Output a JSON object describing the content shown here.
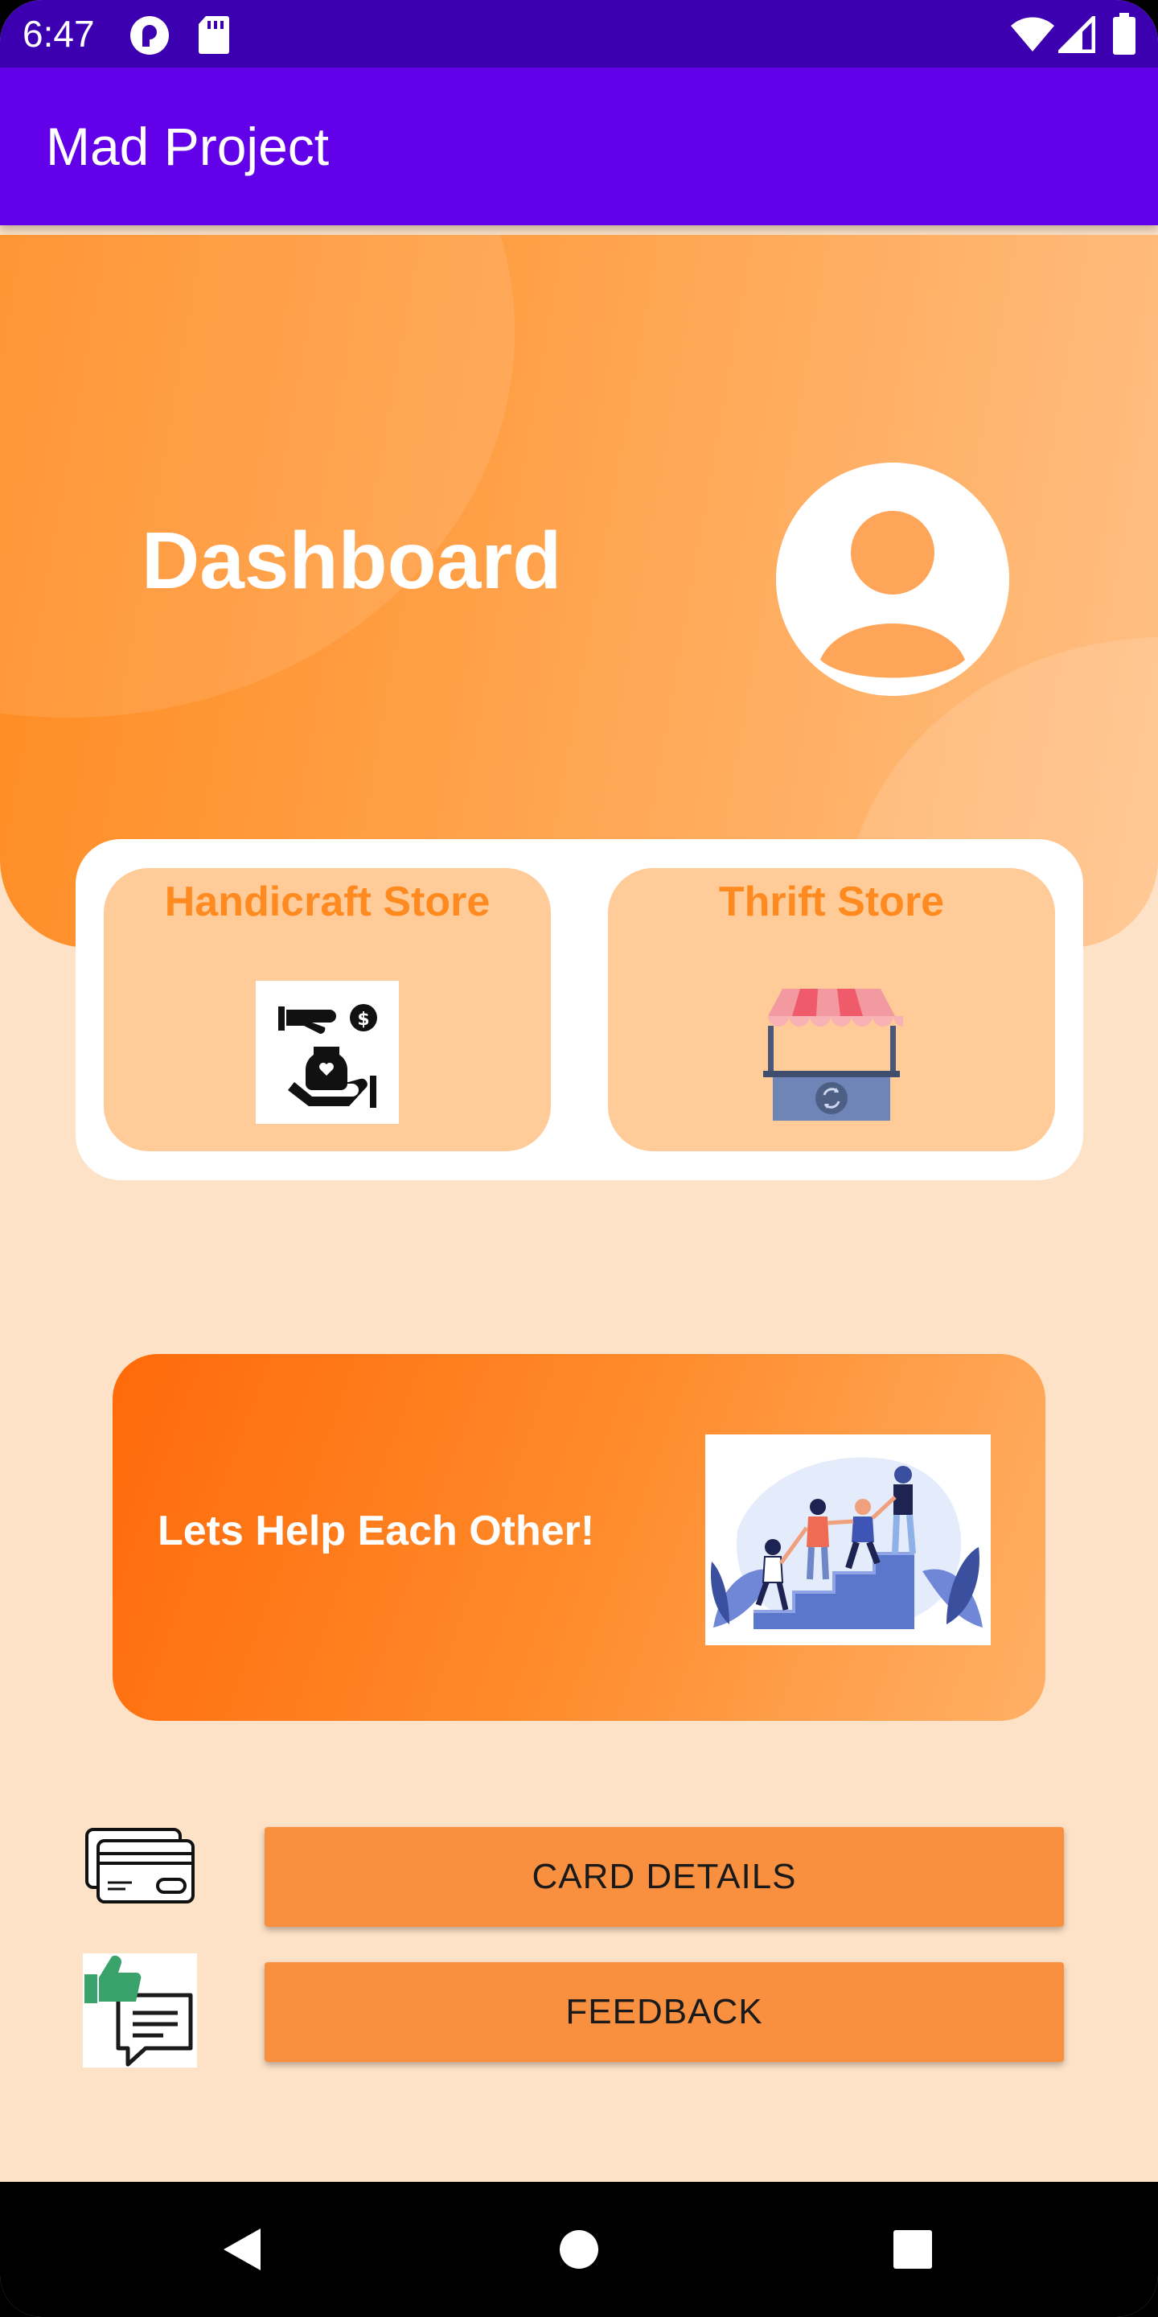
{
  "status_bar": {
    "time": "6:47",
    "icons": [
      "notification-app-icon",
      "sd-card-icon",
      "wifi-icon",
      "signal-icon",
      "battery-icon"
    ]
  },
  "app_bar": {
    "title": "Mad Project"
  },
  "header": {
    "title": "Dashboard",
    "avatar_icon": "account-circle-icon"
  },
  "stores": [
    {
      "title": "Handicraft Store",
      "icon": "donation-hands-icon"
    },
    {
      "title": "Thrift Store",
      "icon": "market-stall-icon"
    }
  ],
  "banner": {
    "text": "Lets Help Each Other!",
    "illustration": "people-climbing-stairs-illustration"
  },
  "actions": [
    {
      "label": "CARD DETAILS",
      "icon": "credit-cards-icon"
    },
    {
      "label": "FEEDBACK",
      "icon": "feedback-thumbs-up-icon"
    }
  ],
  "nav": {
    "icons": [
      "back-icon",
      "home-icon",
      "recents-icon"
    ]
  },
  "colors": {
    "status_bar": "#3d00b0",
    "app_bar": "#6200ea",
    "accent_orange": "#ff8a1f",
    "store_card": "#ffcb98",
    "button": "#f89040",
    "page_bg": "#fde2c7"
  }
}
